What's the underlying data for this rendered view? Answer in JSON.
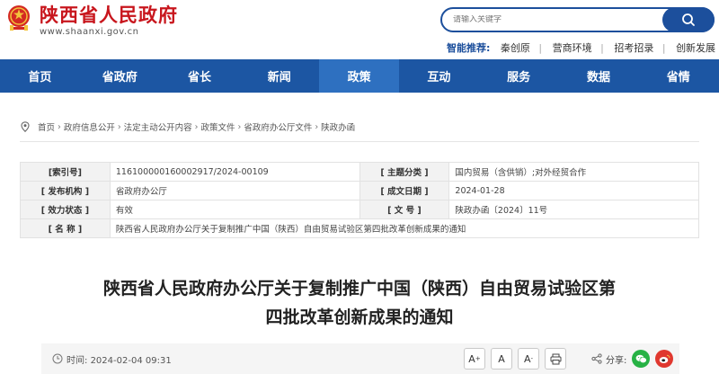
{
  "site": {
    "title": "陕西省人民政府",
    "domain": "www.shaanxi.gov.cn",
    "brand_color": "#c8161d",
    "primary_color": "#1c56a3"
  },
  "search": {
    "placeholder": "请输入关键字"
  },
  "smart": {
    "label": "智能推荐:",
    "items": [
      "秦创原",
      "营商环境",
      "招考招录",
      "创新发展"
    ]
  },
  "nav": {
    "items": [
      "首页",
      "省政府",
      "省长",
      "新闻",
      "政策",
      "互动",
      "服务",
      "数据",
      "省情"
    ],
    "active_index": 4
  },
  "breadcrumb": [
    "首页",
    "政府信息公开",
    "法定主动公开内容",
    "政策文件",
    "省政府办公厅文件",
    "陕政办函"
  ],
  "info": {
    "index_label": "[索引号]",
    "index_value": "116100000160002917/2024-00109",
    "topic_label": "[ 主题分类 ]",
    "topic_value": "国内贸易（含供销）;对外经贸合作",
    "issuer_label": "[ 发布机构 ]",
    "issuer_value": "省政府办公厅",
    "date_label": "[ 成文日期 ]",
    "date_value": "2024-01-28",
    "status_label": "[ 效力状态 ]",
    "status_value": "有效",
    "docno_label": "[ 文 号 ]",
    "docno_value": "陕政办函〔2024〕11号",
    "name_label": "[ 名 称 ]",
    "name_value": "陕西省人民政府办公厅关于复制推广中国（陕西）自由贸易试验区第四批改革创新成果的通知"
  },
  "article": {
    "title_line1": "陕西省人民政府办公厅关于复制推广中国（陕西）自由贸易试验区第",
    "title_line2": "四批改革创新成果的通知"
  },
  "tools": {
    "time_label": "时间:",
    "time_value": "2024-02-04 09:31",
    "font_large": "A",
    "font_large_sup": "+",
    "font_medium": "A",
    "font_small": "A",
    "font_small_sup": "-",
    "share_label": "分享:"
  }
}
